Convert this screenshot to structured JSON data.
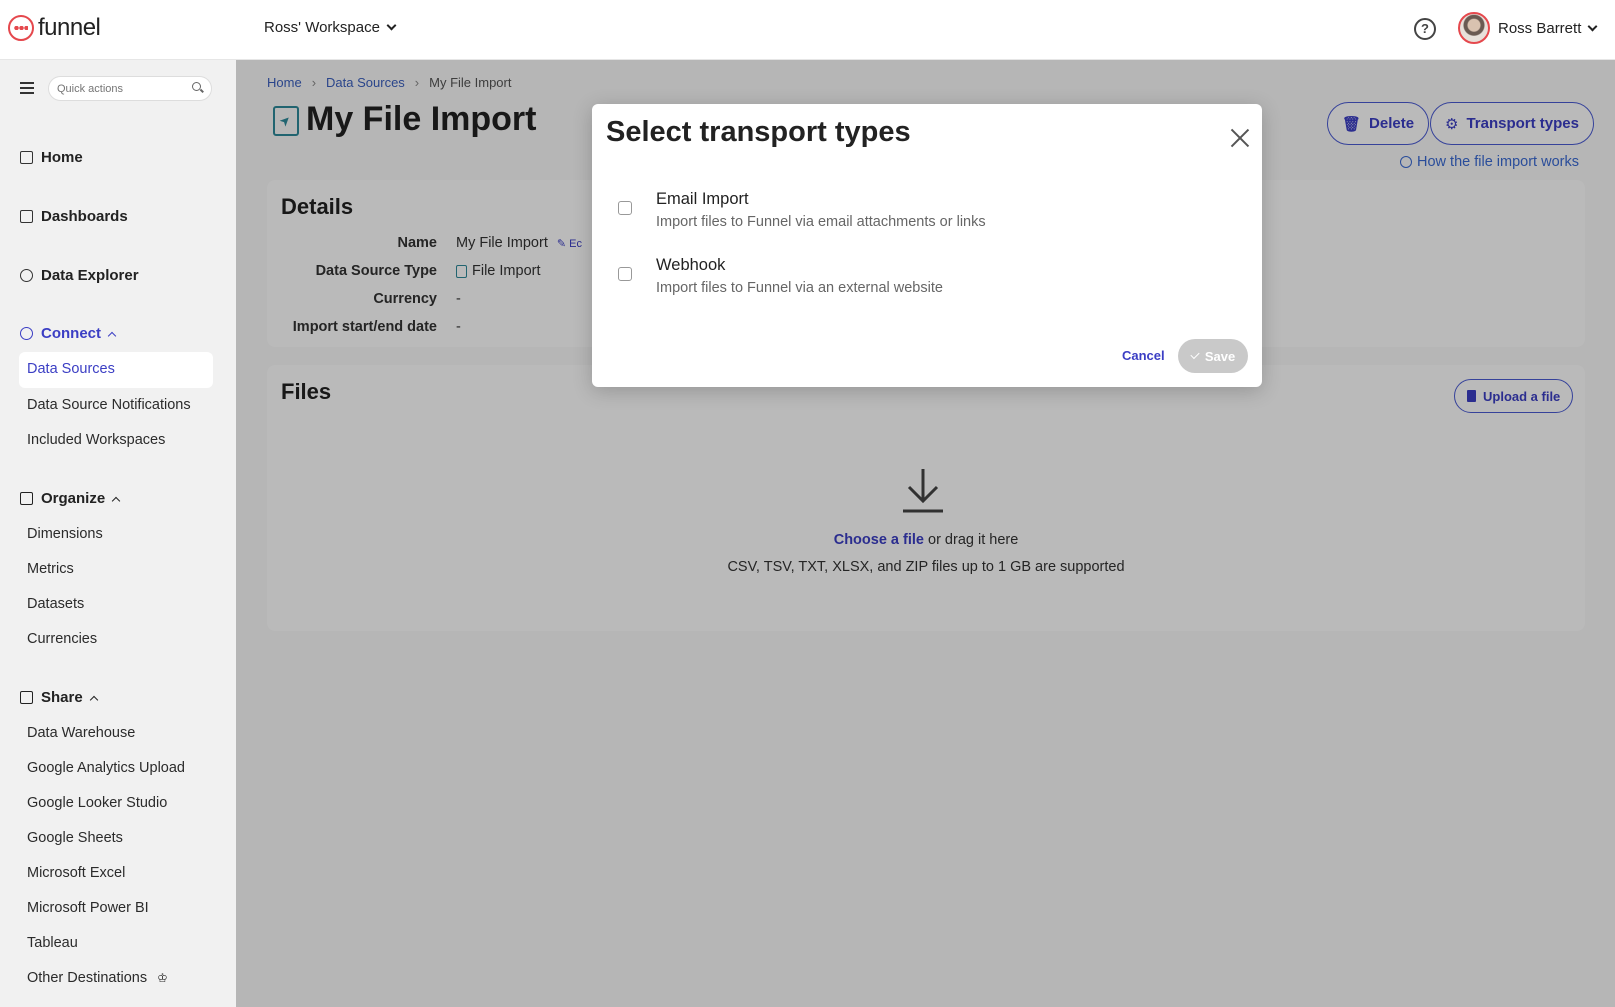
{
  "brand": {
    "name": "funnel",
    "accent": "#3b3ec4",
    "logo_color": "#e5484d"
  },
  "topbar": {
    "workspace": "Ross' Workspace",
    "user_name": "Ross Barrett",
    "help_icon": "question-circle-icon"
  },
  "sidebar": {
    "quick_actions_placeholder": "Quick actions",
    "main_items": [
      {
        "label": "Home",
        "icon": "home-icon"
      },
      {
        "label": "Dashboards",
        "icon": "chart-icon"
      },
      {
        "label": "Data Explorer",
        "icon": "compass-icon"
      }
    ],
    "sections": [
      {
        "label": "Connect",
        "icon": "plug-icon",
        "items": [
          "Data Sources",
          "Data Source Notifications",
          "Included Workspaces"
        ]
      },
      {
        "label": "Organize",
        "icon": "grid-icon",
        "items": [
          "Dimensions",
          "Metrics",
          "Datasets",
          "Currencies"
        ]
      },
      {
        "label": "Share",
        "icon": "export-icon",
        "items": [
          "Data Warehouse",
          "Google Analytics Upload",
          "Google Looker Studio",
          "Google Sheets",
          "Microsoft Excel",
          "Microsoft Power BI",
          "Tableau",
          "Other Destinations"
        ]
      }
    ],
    "selected_item": "Data Sources"
  },
  "breadcrumb": [
    "Home",
    "Data Sources",
    "My File Import"
  ],
  "page": {
    "title": "My File Import",
    "delete_label": "Delete",
    "transport_label": "Transport types",
    "help_link": "How the file import works"
  },
  "details": {
    "heading": "Details",
    "rows": [
      {
        "label": "Name",
        "value": "My File Import",
        "edit": "Ec"
      },
      {
        "label": "Data Source Type",
        "value": "File Import"
      },
      {
        "label": "Currency",
        "value": "-"
      },
      {
        "label": "Import start/end date",
        "value": "-"
      }
    ]
  },
  "files": {
    "heading": "Files",
    "upload_label": "Upload a file",
    "choose_link": "Choose a file",
    "drag_text": "or drag it here",
    "supported_text": "CSV, TSV, TXT, XLSX, and ZIP files up to 1 GB are supported"
  },
  "modal": {
    "title": "Select transport types",
    "options": [
      {
        "title": "Email Import",
        "description": "Import files to Funnel via email attachments or links",
        "checked": false
      },
      {
        "title": "Webhook",
        "description": "Import files to Funnel via an external website",
        "checked": false
      }
    ],
    "cancel_label": "Cancel",
    "save_label": "Save"
  }
}
